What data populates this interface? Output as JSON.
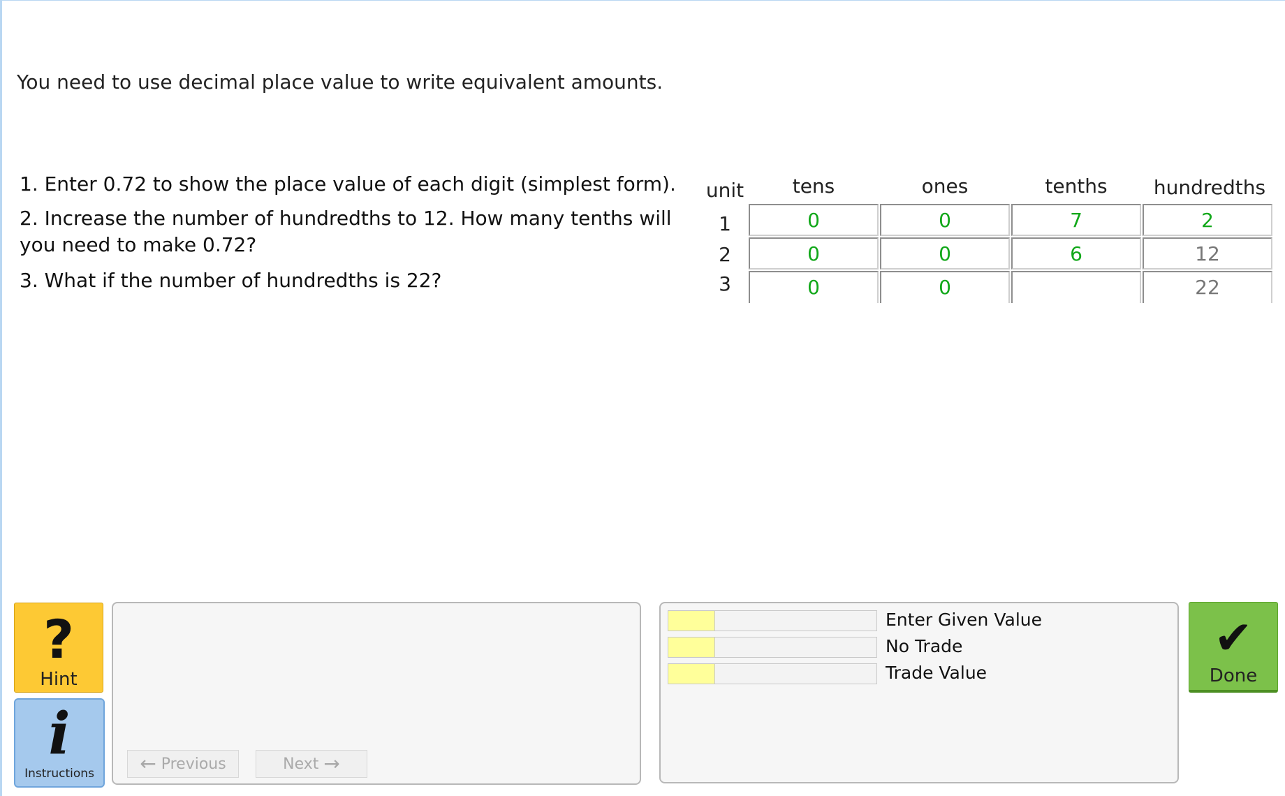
{
  "intro": "You need to use decimal place value to write equivalent amounts.",
  "steps": [
    "1. Enter 0.72 to show the place value of each digit (simplest form).",
    "2. Increase the number of hundredths to 12. How many tenths will you need to make 0.72?",
    "3. What if the number of hundredths is 22?"
  ],
  "table": {
    "unit_header": "unit",
    "columns": [
      "tens",
      "ones",
      "tenths",
      "hundredths"
    ],
    "rows": [
      {
        "label": "1",
        "cells": [
          "0",
          "0",
          "7",
          "2"
        ]
      },
      {
        "label": "2",
        "cells": [
          "0",
          "0",
          "6",
          "12"
        ]
      },
      {
        "label": "3",
        "cells": [
          "0",
          "0",
          "",
          "22"
        ]
      }
    ]
  },
  "hint_button": {
    "label": "Hint",
    "glyph": "?"
  },
  "instructions_button": {
    "label": "Instructions",
    "glyph": "i"
  },
  "nav": {
    "previous": "Previous",
    "next": "Next"
  },
  "skills": [
    {
      "label": "Enter Given Value",
      "level": 0.22
    },
    {
      "label": "No Trade",
      "level": 0.22
    },
    {
      "label": "Trade Value",
      "level": 0.22
    }
  ],
  "done_button": {
    "label": "Done",
    "glyph": "✔"
  },
  "colors": {
    "correct_text": "#12a81a",
    "given_text": "#777777",
    "hint_bg": "#fdc934",
    "instructions_bg": "#a5c9ed",
    "done_bg": "#7cc14a",
    "skill_fill": "#ffff9a"
  }
}
